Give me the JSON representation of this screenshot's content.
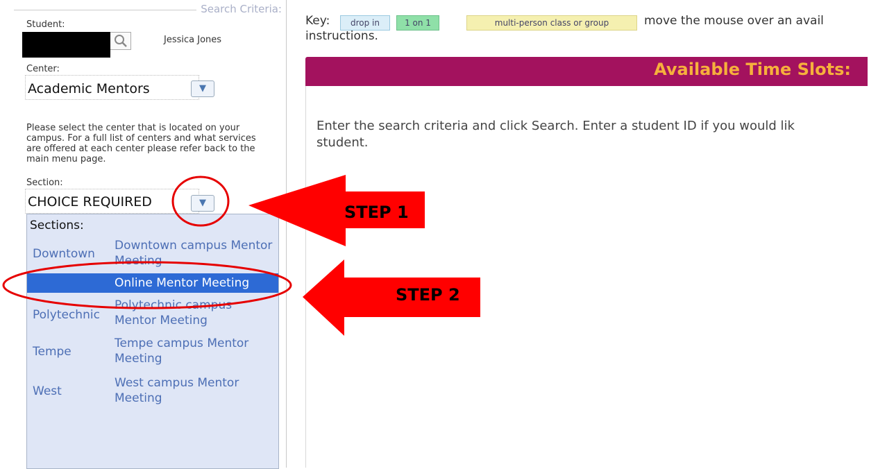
{
  "search_criteria": {
    "legend": "Search Criteria:",
    "student_label": "Student:",
    "student_name": "Jessica Jones",
    "center_label": "Center:",
    "center_value": "Academic Mentors",
    "help_text": "Please select the center that is located on your campus. For a full list of centers and what services are offered at each center please refer back to the main menu page.",
    "section_label": "Section:",
    "section_value": "CHOICE REQUIRED",
    "sections_header": "Sections:",
    "sections": [
      {
        "location": "Downtown",
        "name": "Downtown campus Mentor Meeting",
        "selected": false
      },
      {
        "location": "",
        "name": "Online Mentor Meeting",
        "selected": true
      },
      {
        "location": "Polytechnic",
        "name": "Polytechnic campus Mentor Meeting",
        "selected": false
      },
      {
        "location": "Tempe",
        "name": "Tempe campus Mentor Meeting",
        "selected": false
      },
      {
        "location": "West",
        "name": "West campus Mentor Meeting",
        "selected": false
      }
    ]
  },
  "key": {
    "label": "Key:",
    "chips": [
      {
        "label": "drop in",
        "color": "#dbeef8"
      },
      {
        "label": "1 on 1",
        "color": "#8fe0a8"
      },
      {
        "label": "multi-person class or group",
        "color": "#f5f0b0"
      }
    ],
    "hint": "move the mouse over an avail",
    "hint_line2": "instructions."
  },
  "timeslots": {
    "title": "Available Time Slots:",
    "instructions": "Enter the search criteria and click Search. Enter a student ID if you would lik",
    "instructions_line2": "student."
  },
  "annotations": {
    "step1": "STEP 1",
    "step2": "STEP 2",
    "color": "#ff0000"
  }
}
